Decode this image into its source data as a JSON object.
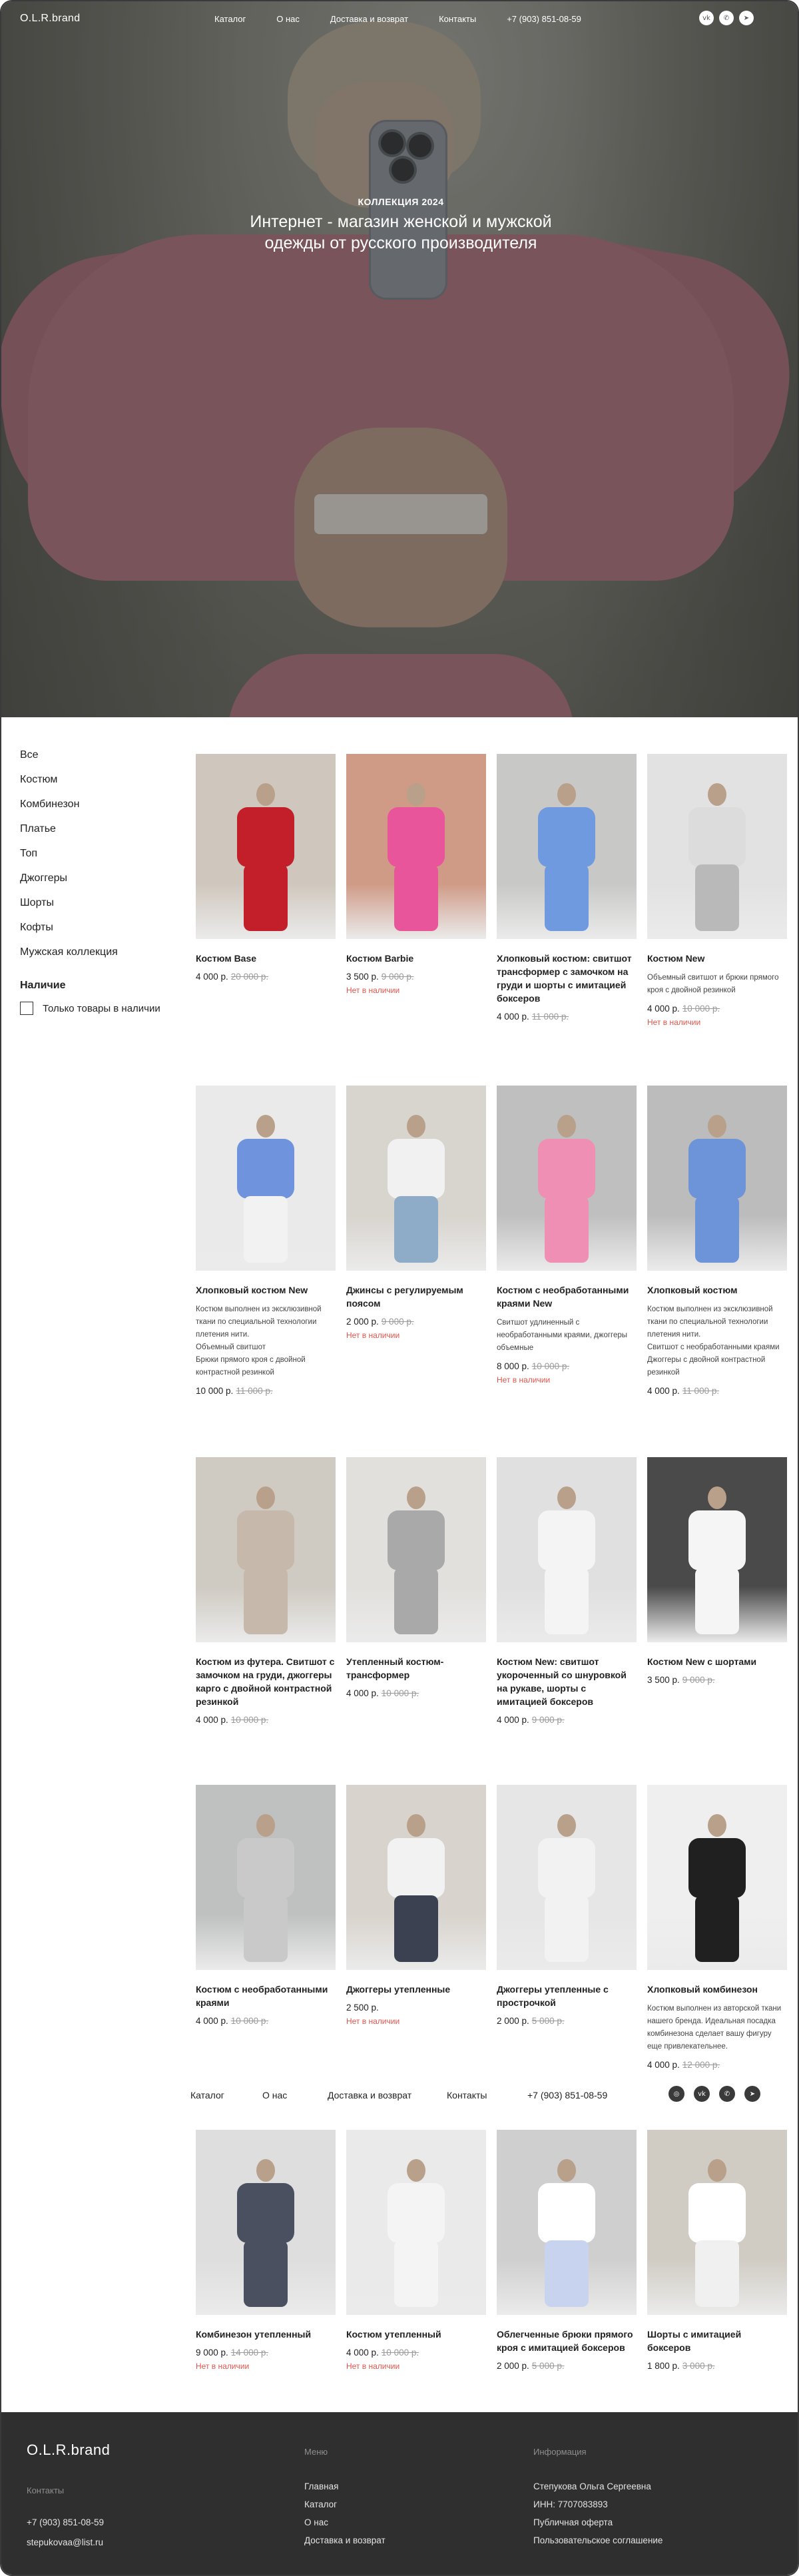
{
  "brand": "O.L.R.brand",
  "nav": {
    "items": [
      "Каталог",
      "О нас",
      "Доставка и возврат",
      "Контакты"
    ],
    "phone": "+7 (903) 851-08-59"
  },
  "hero": {
    "kicker": "КОЛЛЕКЦИЯ 2024",
    "title_line1": "Интернет - магазин женской и мужской",
    "title_line2": "одежды от русского производителя"
  },
  "sidebar": {
    "categories": [
      "Все",
      "Костюм",
      "Комбинезон",
      "Платье",
      "Топ",
      "Джоггеры",
      "Шорты",
      "Кофты",
      "Мужская коллекция"
    ],
    "availability_title": "Наличие",
    "in_stock_only": "Только товары в наличии"
  },
  "products": [
    {
      "name": "Костюм Base",
      "desc": "",
      "price": "4 000 р.",
      "old": "20 000 р.",
      "na": ""
    },
    {
      "name": "Костюм Barbie",
      "desc": "",
      "price": "3 500 р.",
      "old": "9 000 р.",
      "na": "Нет в наличии"
    },
    {
      "name": "Хлопковый костюм: свитшот трансформер с замочком на груди и шорты с имитацией боксеров",
      "desc": "",
      "price": "4 000 р.",
      "old": "11 000 р.",
      "na": ""
    },
    {
      "name": "Костюм New",
      "desc": "Объемный свитшот и брюки прямого кроя с двойной резинкой",
      "price": "4 000 р.",
      "old": "10 000 р.",
      "na": "Нет в наличии"
    },
    {
      "name": "Хлопковый костюм New",
      "desc": "Костюм выполнен из эксклюзивной ткани по специальной технологии плетения нити.\nОбъемный свитшот\nБрюки прямого кроя с двойной контрастной резинкой",
      "price": "10 000 р.",
      "old": "11 000 р.",
      "na": ""
    },
    {
      "name": "Джинсы с регулируемым поясом",
      "desc": "",
      "price": "2 000 р.",
      "old": "9 000 р.",
      "na": "Нет в наличии"
    },
    {
      "name": "Костюм с необработанными краями New",
      "desc": "Свитшот удлиненный с необработанными краями, джоггеры объемные",
      "price": "8 000 р.",
      "old": "10 000 р.",
      "na": "Нет в наличии"
    },
    {
      "name": "Хлопковый костюм",
      "desc": "Костюм выполнен из эксклюзивной ткани по специальной технологии плетения нити.\nСвитшот с необработанными краями\nДжоггеры с двойной контрастной резинкой",
      "price": "4 000 р.",
      "old": "11 000 р.",
      "na": ""
    },
    {
      "name": "Костюм из футера. Свитшот с замочком на груди, джоггеры карго с двойной контрастной резинкой",
      "desc": "",
      "price": "4 000 р.",
      "old": "10 000 р.",
      "na": ""
    },
    {
      "name": "Утепленный костюм-трансформер",
      "desc": "",
      "price": "4 000 р.",
      "old": "10 000 р.",
      "na": ""
    },
    {
      "name": "Костюм New: свитшот укороченный со шнуровкой на рукаве, шорты с имитацией боксеров",
      "desc": "",
      "price": "4 000 р.",
      "old": "9 000 р.",
      "na": ""
    },
    {
      "name": "Костюм New с шортами",
      "desc": "",
      "price": "3 500 р.",
      "old": "9 000 р.",
      "na": ""
    },
    {
      "name": "Костюм с необработанными краями",
      "desc": "",
      "price": "4 000 р.",
      "old": "10 000 р.",
      "na": ""
    },
    {
      "name": "Джоггеры утепленные",
      "desc": "",
      "price": "2 500 р.",
      "old": "",
      "na": "Нет в наличии"
    },
    {
      "name": "Джоггеры утепленные с прострочкой",
      "desc": "",
      "price": "2 000 р.",
      "old": "5 000 р.",
      "na": ""
    },
    {
      "name": "Хлопковый комбинезон",
      "desc": "Костюм выполнен из авторской ткани нашего бренда. Идеальная посадка комбинезона сделает вашу фигуру еще привлекательнее.",
      "price": "4 000 р.",
      "old": "12 000 р.",
      "na": ""
    },
    {
      "name": "Комбинезон утепленный",
      "desc": "",
      "price": "9 000 р.",
      "old": "14 000 р.",
      "na": "Нет в наличии"
    },
    {
      "name": "Костюм утепленный",
      "desc": "",
      "price": "4 000 р.",
      "old": "10 000 р.",
      "na": "Нет в наличии"
    },
    {
      "name": "Облегченные брюки прямого кроя с имитацией боксеров",
      "desc": "",
      "price": "2 000 р.",
      "old": "5 000 р.",
      "na": ""
    },
    {
      "name": "Шорты с имитацией боксеров",
      "desc": "",
      "price": "1 800 р.",
      "old": "3 000 р.",
      "na": ""
    }
  ],
  "footer": {
    "brand": "O.L.R.brand",
    "contacts_label": "Контакты",
    "phone": "+7 (903) 851-08-59",
    "email": "stepukovaa@list.ru",
    "menu_label": "Меню",
    "menu_items": [
      "Главная",
      "Каталог",
      "О нас",
      "Доставка и возврат"
    ],
    "info_label": "Информация",
    "info_items": [
      "Степукова Ольга Сергеевна",
      "ИНН: 7707083893",
      "Публичная оферта",
      "Пользовательское соглашение"
    ]
  },
  "colors": {
    "accent_red": "#e0554c",
    "footer_bg": "#2f2f2f"
  }
}
